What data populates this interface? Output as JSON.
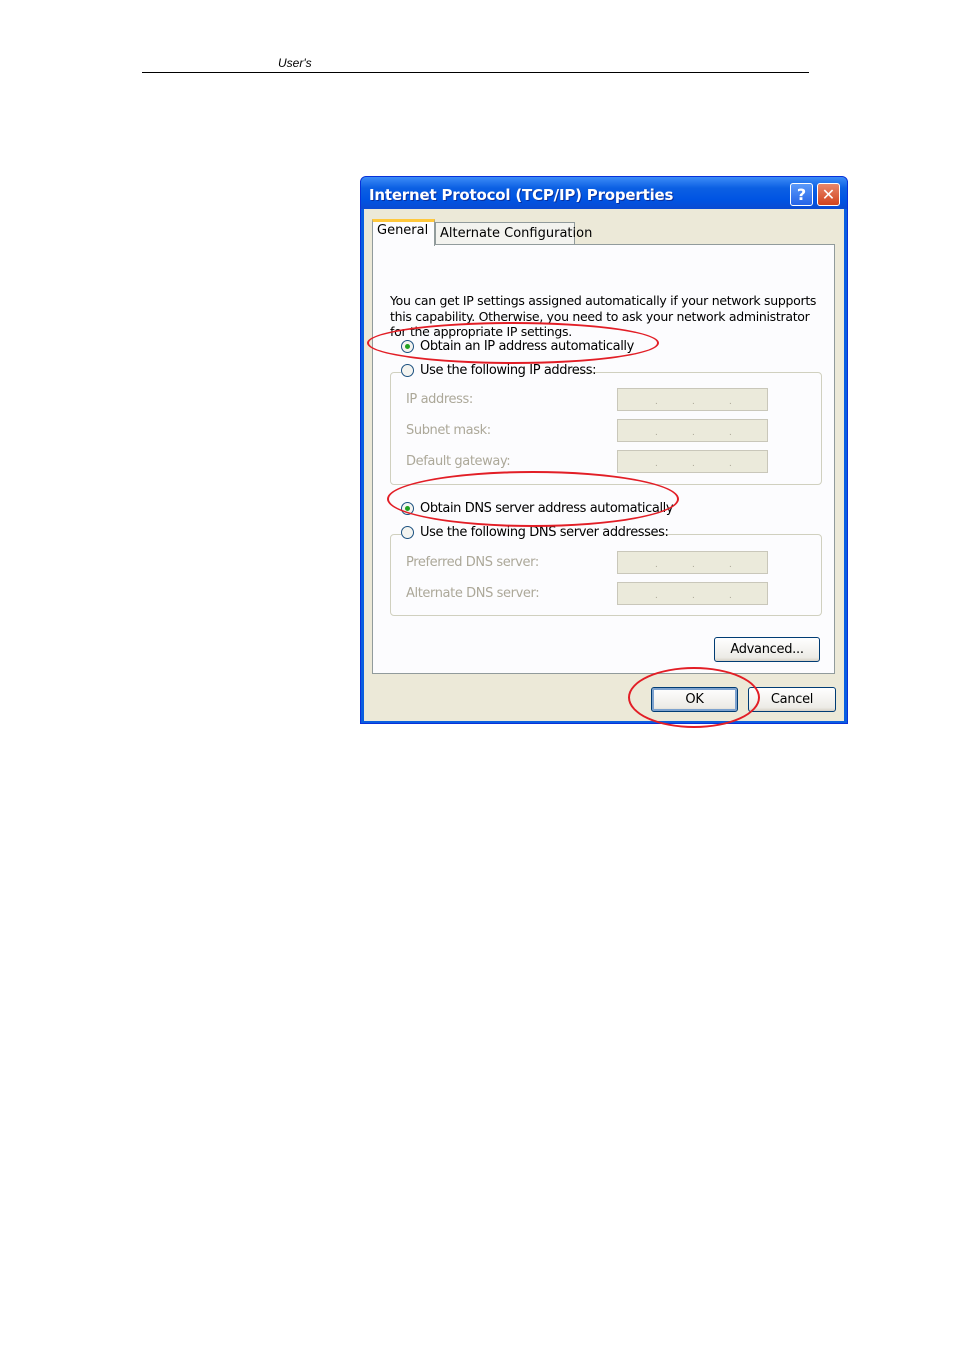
{
  "document": {
    "header_text": "User's"
  },
  "dialog": {
    "title": "Internet Protocol (TCP/IP) Properties",
    "help_glyph": "?",
    "close_glyph": "✕",
    "tabs": [
      {
        "label": "General",
        "selected": true
      },
      {
        "label": "Alternate Configuration",
        "selected": false
      }
    ],
    "intro_text": "You can get IP settings assigned automatically if your network supports this capability. Otherwise, you need to ask your network administrator for the appropriate IP settings.",
    "ip_mode": {
      "auto_label": "Obtain an IP address automatically",
      "auto_selected": true,
      "manual_label": "Use the following IP address:",
      "manual_selected": false
    },
    "ip_fields": [
      {
        "label": "IP address:",
        "value": ". . ."
      },
      {
        "label": "Subnet mask:",
        "value": ". . ."
      },
      {
        "label": "Default gateway:",
        "value": ". . ."
      }
    ],
    "dns_mode": {
      "auto_label": "Obtain DNS server address automatically",
      "auto_selected": true,
      "manual_label": "Use the following DNS server addresses:",
      "manual_selected": false
    },
    "dns_fields": [
      {
        "label": "Preferred DNS server:",
        "value": ". . ."
      },
      {
        "label": "Alternate DNS server:",
        "value": ". . ."
      }
    ],
    "advanced_label": "Advanced...",
    "ok_label": "OK",
    "cancel_label": "Cancel"
  },
  "colors": {
    "annotation": "#e21e26",
    "titlebar": "#0054e3",
    "dialog_bg": "#ece9d8",
    "radio_dot": "#21a121"
  }
}
